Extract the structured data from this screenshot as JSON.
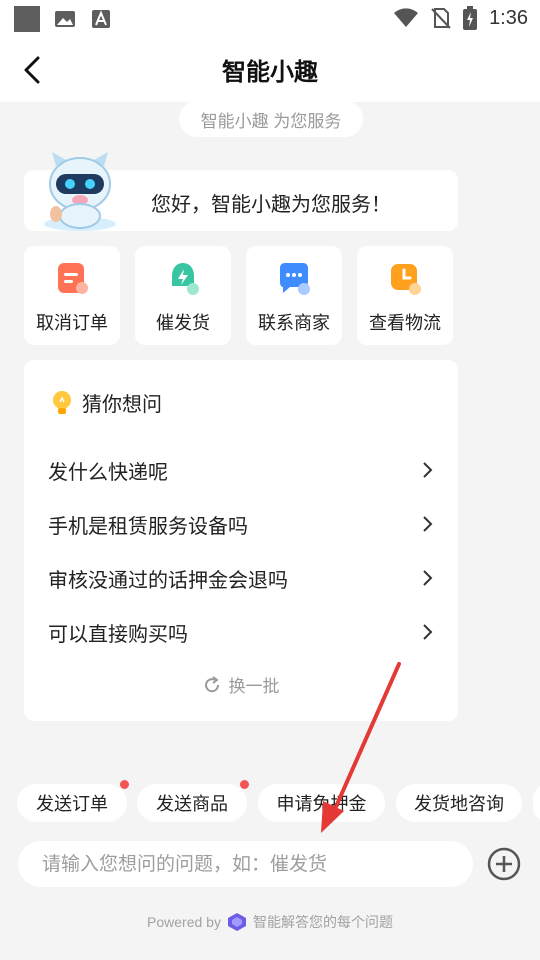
{
  "status_bar": {
    "time": "1:36"
  },
  "header": {
    "title": "智能小趣"
  },
  "service_pill": "智能小趣 为您服务",
  "greeting": "您好，智能小趣为您服务！",
  "quick_actions": [
    {
      "label": "取消订单",
      "icon": "cancel-order-icon"
    },
    {
      "label": "催发货",
      "icon": "urge-shipping-icon"
    },
    {
      "label": "联系商家",
      "icon": "contact-merchant-icon"
    },
    {
      "label": "查看物流",
      "icon": "logistics-icon"
    }
  ],
  "faq": {
    "title": "猜你想问",
    "items": [
      "发什么快递呢",
      "手机是租赁服务设备吗",
      "审核没通过的话押金会退吗",
      "可以直接购买吗"
    ],
    "refresh_label": "换一批"
  },
  "chips": [
    {
      "label": "发送订单",
      "has_dot": true
    },
    {
      "label": "发送商品",
      "has_dot": true
    },
    {
      "label": "申请免押金",
      "has_dot": false
    },
    {
      "label": "发货地咨询",
      "has_dot": false
    }
  ],
  "input": {
    "placeholder": "请输入您想问的问题，如：催发货",
    "value": ""
  },
  "footer": {
    "powered_by": "Powered by",
    "tagline": "智能解答您的每个问题"
  },
  "colors": {
    "accent_red": "#e53935",
    "dot_red": "#f25353",
    "muted": "#9a9a9a"
  }
}
